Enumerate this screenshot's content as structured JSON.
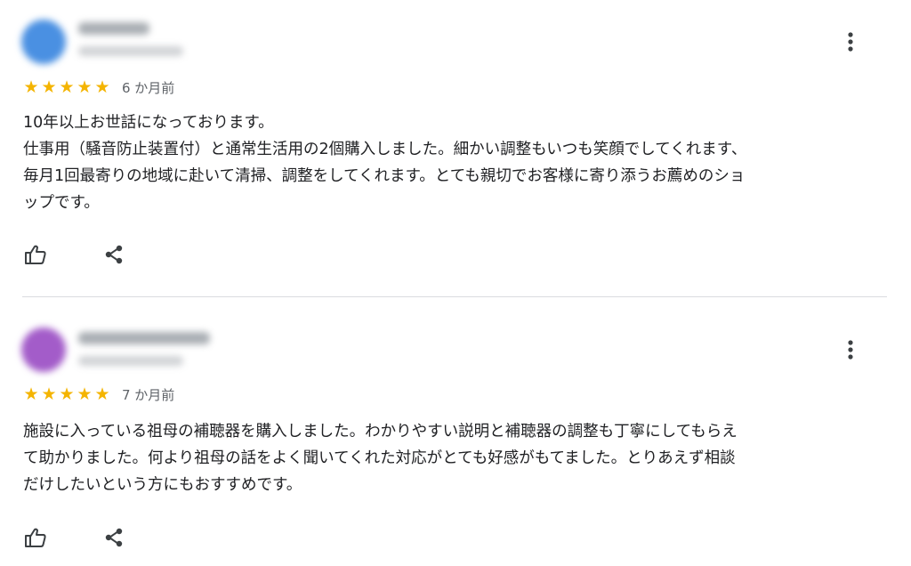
{
  "reviews": [
    {
      "avatar_color": "#4a90e2",
      "rating": 5,
      "stars": "★★★★★",
      "date": "6 か月前",
      "text": "10年以上お世話になっております。\n仕事用（騒音防止装置付）と通常生活用の2個購入しました。細かい調整もいつも笑顔でしてくれます、\n毎月1回最寄りの地域に赴いて清掃、調整をしてくれます。とても親切でお客様に寄り添うお薦めのショ\nップです。",
      "icons": {
        "more": "more-vert-icon",
        "like": "thumb-up-icon",
        "share": "share-icon"
      }
    },
    {
      "avatar_color": "#a35cc9",
      "rating": 5,
      "stars": "★★★★★",
      "date": "7 か月前",
      "text": "施設に入っている祖母の補聴器を購入しました。わかりやすい説明と補聴器の調整も丁寧にしてもらえ\nて助かりました。何より祖母の話をよく聞いてくれた対応がとても好感がもてました。とりあえず相談\nだけしたいという方にもおすすめです。",
      "icons": {
        "more": "more-vert-icon",
        "like": "thumb-up-icon",
        "share": "share-icon"
      }
    }
  ],
  "colors": {
    "star": "#f4b400",
    "icon": "#3c4043",
    "divider": "#dadce0"
  }
}
